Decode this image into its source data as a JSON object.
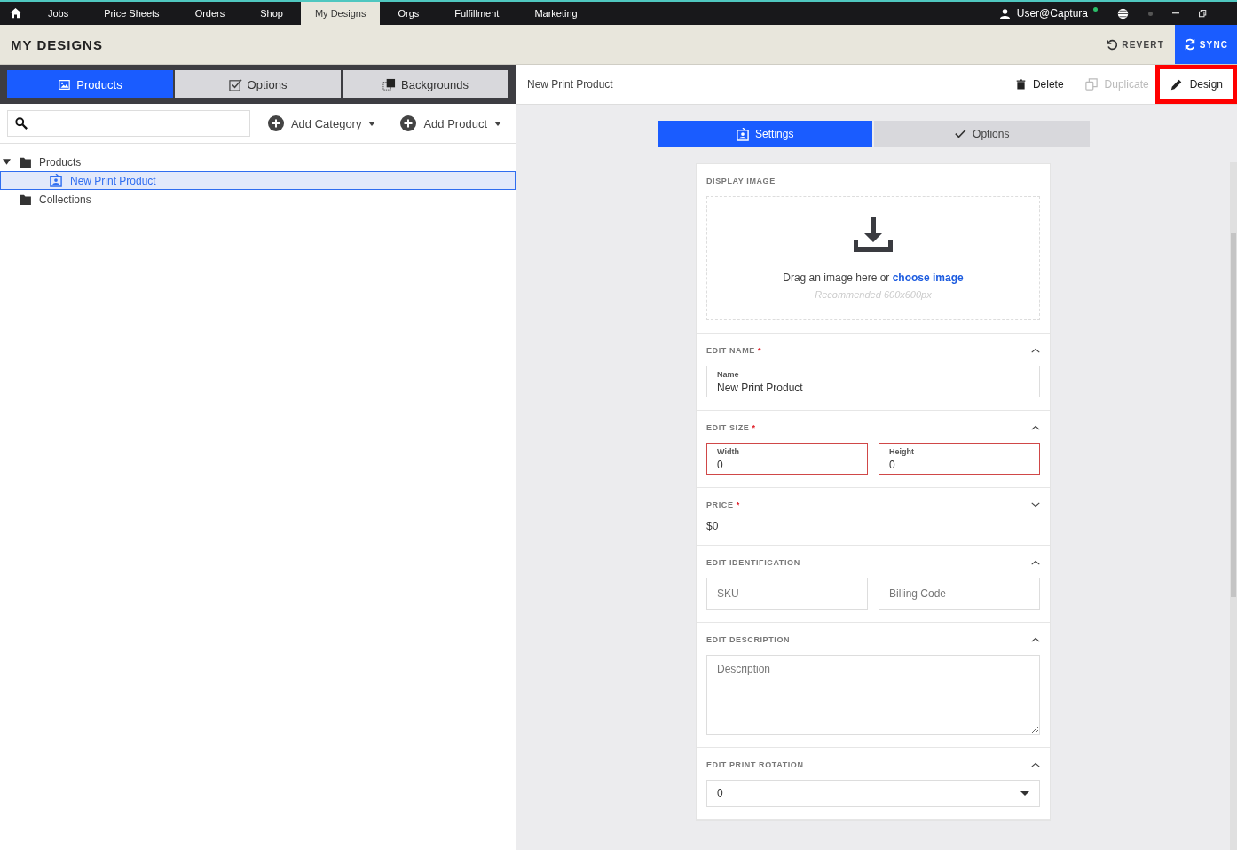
{
  "nav": {
    "items": [
      {
        "label": "Jobs",
        "selected": false
      },
      {
        "label": "Price Sheets",
        "selected": false
      },
      {
        "label": "Orders",
        "selected": false
      },
      {
        "label": "Shop",
        "selected": false
      },
      {
        "label": "My Designs",
        "selected": true
      },
      {
        "label": "Orgs",
        "selected": false
      },
      {
        "label": "Fulfillment",
        "selected": false
      },
      {
        "label": "Marketing",
        "selected": false
      }
    ],
    "user": "User@Captura"
  },
  "header": {
    "title": "MY DESIGNS",
    "actions": [
      {
        "label": "REVERT",
        "kind": "revert"
      },
      {
        "label": "SYNC",
        "kind": "sync"
      }
    ]
  },
  "library": {
    "tabs": [
      {
        "label": "Products",
        "kind": "image",
        "selected": true
      },
      {
        "label": "Options",
        "kind": "checkbox",
        "selected": false
      },
      {
        "label": "Backgrounds",
        "kind": "layers",
        "selected": false
      }
    ],
    "add_buttons": [
      "Add Category",
      "Add Product"
    ],
    "tree": [
      {
        "label": "Products",
        "kind": "folder",
        "selected": false,
        "expanded": true,
        "children": [
          {
            "label": "New Print Product",
            "kind": "product",
            "selected": true
          }
        ]
      },
      {
        "label": "Collections",
        "kind": "folder",
        "selected": false
      }
    ]
  },
  "editor": {
    "title": "New Print Product",
    "actions": [
      {
        "label": "Delete",
        "kind": "delete",
        "disabled": false,
        "highlighted": false
      },
      {
        "label": "Duplicate",
        "kind": "duplicate",
        "disabled": true,
        "highlighted": false
      },
      {
        "label": "Design",
        "kind": "design",
        "disabled": false,
        "highlighted": true
      }
    ],
    "tabs": [
      {
        "label": "Settings",
        "kind": "settings",
        "selected": true
      },
      {
        "label": "Options",
        "kind": "check",
        "selected": false
      }
    ],
    "sections": [
      {
        "kind": "image",
        "title": "DISPLAY IMAGE",
        "prompt": "Drag an image here or",
        "link": "choose image",
        "hint": "Recommended 600x600px"
      },
      {
        "kind": "fields",
        "title": "EDIT NAME",
        "required": "*",
        "expanded": true,
        "fields": [
          {
            "label": "Name",
            "value": "New Print Product",
            "invalid": false
          }
        ]
      },
      {
        "kind": "fields",
        "title": "EDIT SIZE",
        "required": "*",
        "expanded": true,
        "fields": [
          {
            "label": "Width",
            "value": "0",
            "invalid": true
          },
          {
            "label": "Height",
            "value": "0",
            "invalid": true
          }
        ]
      },
      {
        "kind": "text",
        "title": "PRICE",
        "required": "*",
        "expanded": false,
        "value": "$0"
      },
      {
        "kind": "fields",
        "title": "EDIT IDENTIFICATION",
        "expanded": true,
        "fields": [
          {
            "placeholder": "SKU",
            "invalid": false
          },
          {
            "placeholder": "Billing Code",
            "invalid": false
          }
        ]
      },
      {
        "kind": "textarea",
        "title": "EDIT DESCRIPTION",
        "expanded": true,
        "placeholder": "Description"
      },
      {
        "kind": "select",
        "title": "EDIT PRINT ROTATION",
        "expanded": true,
        "value": "0"
      }
    ]
  }
}
